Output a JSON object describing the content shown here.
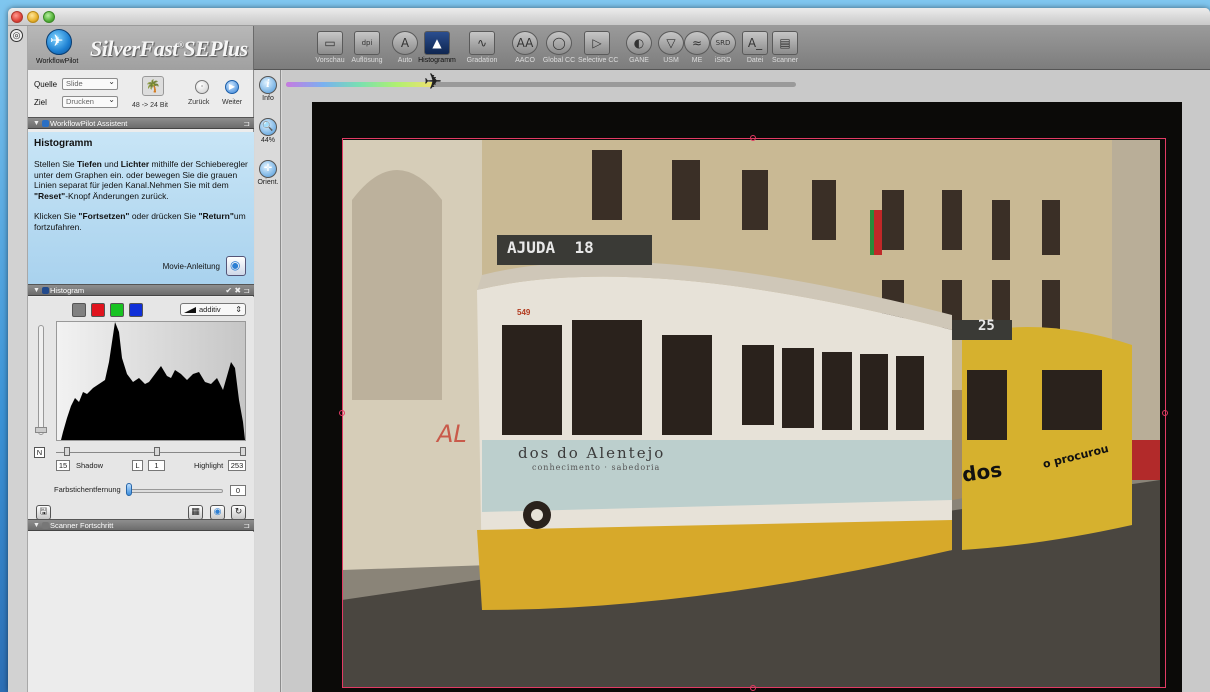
{
  "window": {
    "title": "SilverFast SE Plus"
  },
  "brand": {
    "name": "SilverFast",
    "suffix": "SEPlus",
    "workflowpilot_label": "WorkflowPilot"
  },
  "toolbar": {
    "buttons": [
      {
        "label": "Vorschau",
        "icon": "preview-icon"
      },
      {
        "label": "Auflösung",
        "icon": "resolution-icon"
      },
      {
        "label": "Auto",
        "icon": "auto-icon"
      },
      {
        "label": "Histogramm",
        "icon": "histogram-icon",
        "active": true
      },
      {
        "label": "Gradation",
        "icon": "gradation-icon"
      },
      {
        "label": "AACO",
        "icon": "aaco-icon"
      },
      {
        "label": "Global CC",
        "icon": "global-cc-icon"
      },
      {
        "label": "Selective CC",
        "icon": "selective-cc-icon"
      },
      {
        "label": "GANE",
        "icon": "gane-icon"
      },
      {
        "label": "USM",
        "icon": "usm-icon"
      },
      {
        "label": "ME",
        "icon": "me-icon"
      },
      {
        "label": "iSRD",
        "icon": "isrd-icon"
      },
      {
        "label": "Datei",
        "icon": "file-icon"
      },
      {
        "label": "Scanner",
        "icon": "scanner-icon"
      }
    ]
  },
  "source": {
    "quelle_label": "Quelle",
    "quelle_value": "Slide",
    "ziel_label": "Ziel",
    "ziel_value": "Drucken",
    "bitdepth": "48 -> 24 Bit",
    "back_label": "Zurück",
    "next_label": "Weiter"
  },
  "assistant": {
    "header": "WorkflowPilot Assistent",
    "title": "Histogramm",
    "p1_a": "Stellen Sie ",
    "p1_b1": "Tiefen",
    "p1_c": " und ",
    "p1_b2": "Lichter",
    "p1_d": " mithilfe der Schieberegler unter dem Graphen ein. oder bewegen Sie die grauen Linien separat für jeden Kanal.Nehmen Sie mit dem ",
    "p1_b3": "\"Reset\"",
    "p1_e": "-Knopf Änderungen zurück.",
    "p2_a": "Klicken Sie ",
    "p2_b1": "\"Fortsetzen\"",
    "p2_c": " oder drücken Sie ",
    "p2_b2": "\"Return\"",
    "p2_d": "um fortzufahren.",
    "movie_label": "Movie-Anleitung"
  },
  "histogram_panel": {
    "header": "Histogram",
    "header_right": "✔ ✖",
    "mode": "additiv",
    "channels": [
      "#808080",
      "#e0141e",
      "#18c322",
      "#1030d8"
    ],
    "n_label": "N",
    "shadow_value": "15",
    "shadow_label": "Shadow",
    "l_label": "L",
    "mid_value": "1",
    "highlight_label": "Highlight",
    "highlight_value": "253",
    "farbstich_label": "Farbstichentfernung",
    "farbstich_value": "0"
  },
  "scanner_panel": {
    "header": "Scanner Fortschritt"
  },
  "tool_column": {
    "info_label": "Info",
    "zoom_label": "44%",
    "orient_label": "Orient."
  },
  "preview": {
    "progress": 0.29,
    "colors": {
      "crop": "#e23b64"
    }
  },
  "photo_text": {
    "tram_dest": "AJUDA",
    "tram_num": "18",
    "tram_num2": "25",
    "fleet_num": "549",
    "ad_text": "dos do Alentejo",
    "ad_sub": "conhecimento · sabedoria",
    "tram2_ad": "dos",
    "tram2_ad2": "o procurou",
    "graffiti": "AL"
  }
}
